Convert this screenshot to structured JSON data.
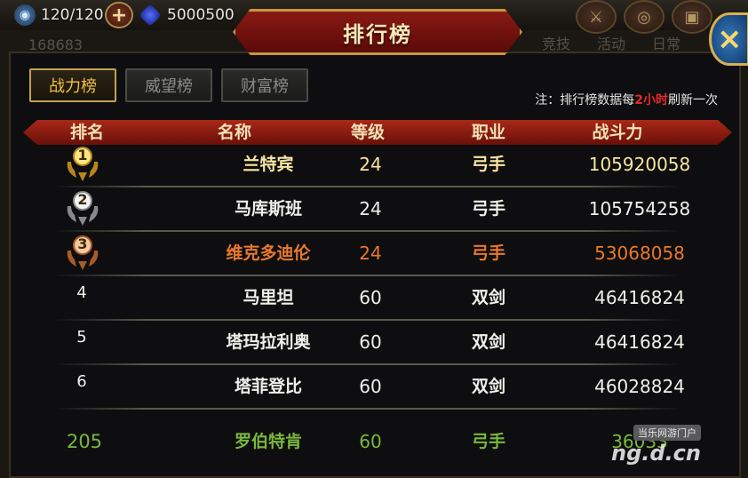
{
  "hud": {
    "energy": "120/120",
    "gems": "5000500",
    "bg_score": "168683",
    "bg_tabs": [
      "竞技",
      "活动",
      "日常"
    ]
  },
  "dialog": {
    "title": "排行榜",
    "close_label": "×"
  },
  "tabs": [
    {
      "label": "战力榜",
      "active": true
    },
    {
      "label": "威望榜",
      "active": false
    },
    {
      "label": "财富榜",
      "active": false
    }
  ],
  "note": {
    "prefix": "注：排行榜数据每",
    "highlight": "2小时",
    "suffix": "刷新一次"
  },
  "columns": {
    "rank": "排名",
    "name": "名称",
    "level": "等级",
    "job": "职业",
    "power": "战斗力"
  },
  "rows": [
    {
      "rank": "1",
      "name": "兰特宾",
      "level": "24",
      "job": "弓手",
      "power": "105920058",
      "medal": "gold"
    },
    {
      "rank": "2",
      "name": "马库斯班",
      "level": "24",
      "job": "弓手",
      "power": "105754258",
      "medal": "silver"
    },
    {
      "rank": "3",
      "name": "维克多迪伦",
      "level": "24",
      "job": "弓手",
      "power": "53068058",
      "medal": "bronze"
    },
    {
      "rank": "4",
      "name": "马里坦",
      "level": "60",
      "job": "双剑",
      "power": "46416824",
      "medal": ""
    },
    {
      "rank": "5",
      "name": "塔玛拉利奥",
      "level": "60",
      "job": "双剑",
      "power": "46416824",
      "medal": ""
    },
    {
      "rank": "6",
      "name": "塔菲登比",
      "level": "60",
      "job": "双剑",
      "power": "46028824",
      "medal": ""
    }
  ],
  "self_row": {
    "rank": "205",
    "name": "罗伯特肯",
    "level": "60",
    "job": "弓手",
    "power": "36033"
  },
  "colors": {
    "gold_text": "#f7e6a0",
    "bronze_text": "#e8782c",
    "self_text": "#7ab83c",
    "white_text": "#f0f0ea"
  },
  "watermark": {
    "top": "当乐网游门户",
    "main": "ng.d.cn"
  }
}
